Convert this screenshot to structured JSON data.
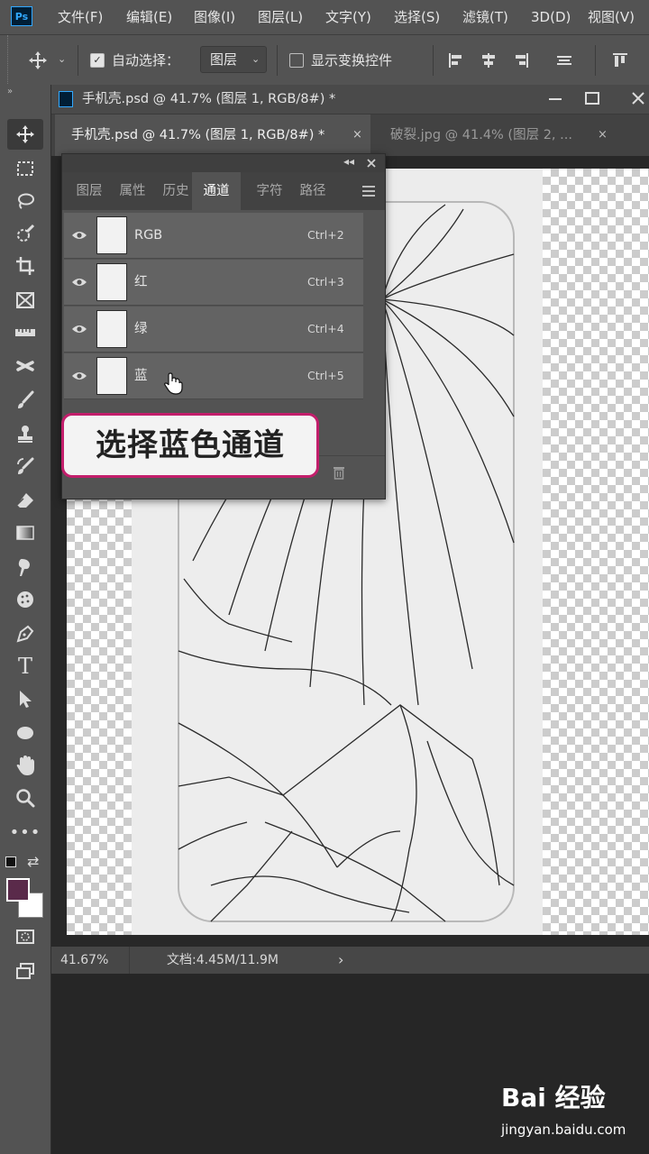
{
  "menubar": {
    "app_logo": "Ps",
    "items": [
      "文件(F)",
      "编辑(E)",
      "图像(I)",
      "图层(L)",
      "文字(Y)",
      "选择(S)",
      "滤镜(T)",
      "3D(D)",
      "视图(V)"
    ]
  },
  "options_bar": {
    "auto_select_label": "自动选择：",
    "auto_select_checked": true,
    "auto_select_target": "图层",
    "show_transform_label": "显示变换控件",
    "show_transform_checked": false
  },
  "document": {
    "window_title": "手机壳.psd @ 41.7% (图层 1, RGB/8#) *",
    "tabs": [
      {
        "label": "手机壳.psd @ 41.7% (图层 1, RGB/8#) *",
        "active": true
      },
      {
        "label": "破裂.jpg @ 41.4% (图层 2, ...",
        "active": false
      }
    ],
    "close_glyph": "×",
    "zoom": "41.67%",
    "doc_size": "文档:4.45M/11.9M",
    "status_arrow": "›"
  },
  "channels_panel": {
    "tabs": [
      "图层",
      "属性",
      "历史",
      "通道",
      "字符",
      "路径"
    ],
    "active_tab": "通道",
    "channels": [
      {
        "name": "RGB",
        "shortcut": "Ctrl+2"
      },
      {
        "name": "红",
        "shortcut": "Ctrl+3"
      },
      {
        "name": "绿",
        "shortcut": "Ctrl+4"
      },
      {
        "name": "蓝",
        "shortcut": "Ctrl+5"
      }
    ]
  },
  "caption": "选择蓝色通道",
  "watermark": {
    "logo": "Bai 经验",
    "url": "jingyan.baidu.com"
  },
  "colors": {
    "foreground": "#5a2a4a",
    "background": "#ffffff",
    "caption_border": "#c21e6b",
    "ui_panel": "#535353"
  }
}
